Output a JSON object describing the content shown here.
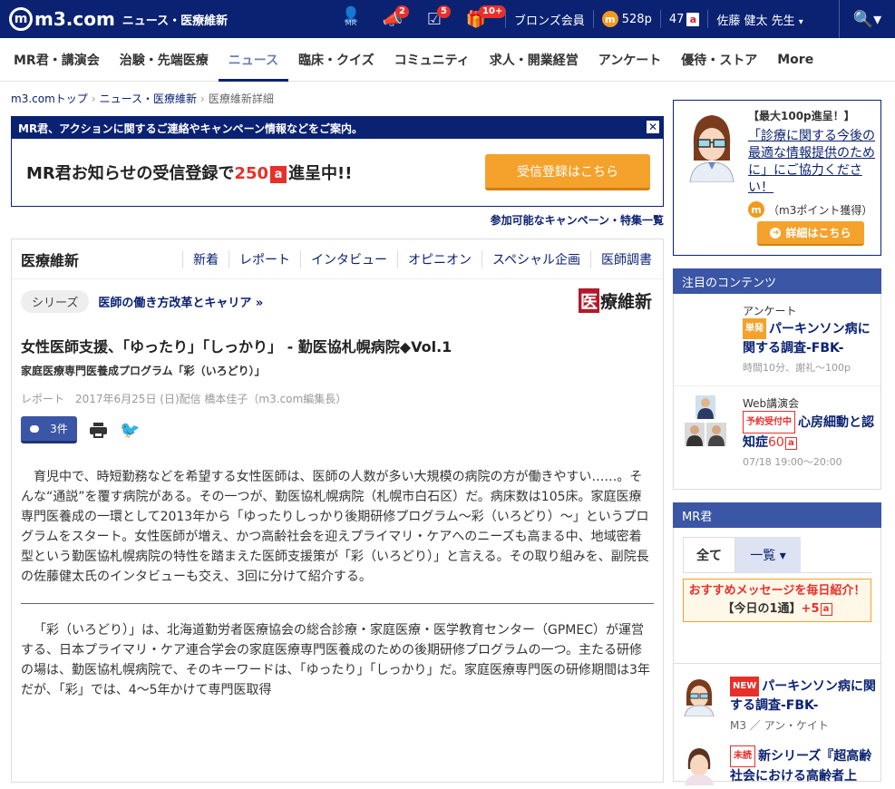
{
  "header": {
    "logo": "m3.com",
    "logo_mark": "m",
    "section": "ニュース・医療維新",
    "icon_badges": {
      "mr": "",
      "notifications": "2",
      "tasks": "5",
      "gifts": "10+"
    },
    "mr_label": "MR",
    "member_rank": "ブロンズ会員",
    "points": "528p",
    "point_mark": "m",
    "coupons": "47",
    "coupon_mark": "a",
    "user": "佐藤 健太 先生",
    "user_caret": "▾",
    "search_glyph": "🔍▾"
  },
  "nav": [
    "MR君・講演会",
    "治験・先端医療",
    "ニュース",
    "臨床・クイズ",
    "コミュニティ",
    "求人・開業経営",
    "アンケート",
    "優待・ストア",
    "More"
  ],
  "breadcrumb": [
    "m3.comトップ",
    "ニュース・医療維新",
    "医療維新詳細"
  ],
  "notice": {
    "head": "MR君、アクションに関するご連絡やキャンペーン情報などをご案内。",
    "close": "✕",
    "text_pre": "MR君お知らせの受信登録で",
    "text_num": "250",
    "text_mark": "a",
    "text_post": "進呈中!!",
    "button": "受信登録はこちら",
    "campaign_link": "参加可能なキャンペーン・特集一覧"
  },
  "article": {
    "section_title": "医療維新",
    "tabs": [
      "新着",
      "レポート",
      "インタビュー",
      "オピニオン",
      "スペシャル企画",
      "医師調書"
    ],
    "series_tag": "シリーズ",
    "series_link": "医師の働き方改革とキャリア »",
    "brand_k": "医",
    "brand_rest": "療維新",
    "title": "女性医師支援、「ゆったり」「しっかり」 - 勤医協札幌病院◆Vol.1",
    "subtitle": "家庭医療専門医養成プログラム「彩（いろどり）」",
    "meta": "レポート　2017年6月25日 (日)配信 橋本佳子（m3.com編集長）",
    "comment_count": "3件",
    "tw": "🐦",
    "body1": "育児中で、時短勤務などを希望する女性医師は、医師の人数が多い大規模の病院の方が働きやすい……。そんな“通説”を覆す病院がある。その一つが、勤医協札幌病院（札幌市白石区）だ。病床数は105床。家庭医療専門医養成の一環として2013年から「ゆったりしっかり後期研修プログラム～彩（いろどり）～」というプログラムをスタート。女性医師が増え、かつ高齢社会を迎えプライマリ・ケアへのニーズも高まる中、地域密着型という勤医協札幌病院の特性を踏まえた医師支援策が「彩（いろどり）」と言える。その取り組みを、副院長の佐藤健太氏のインタビューも交え、3回に分けて紹介する。",
    "body2": "「彩（いろどり）」は、北海道勤労者医療協会の総合診療・家庭医療・医学教育センター（GPMEC）が運営する、日本プライマリ・ケア連合学会の家庭医療専門医養成のための後期研修プログラムの一つ。主たる研修の場は、勤医協札幌病院で、そのキーワードは、「ゆったり」「しっかり」だ。家庭医療専門医の研修期間は3年だが、「彩」では、4～5年かけて専門医取得"
  },
  "side": {
    "ad_title": "【最大100p進呈！】",
    "ad_link": "「診療に関する今後の最適な情報提供のために」にご協力ください！",
    "ad_point": "（m3ポイント獲得）",
    "ad_point_mark": "m",
    "ad_button": "詳細はこちら",
    "ad_button_arrow": "➜",
    "featured_head": "注目のコンテンツ",
    "featured": [
      {
        "category": "アンケート",
        "tag": "単発",
        "title": "パーキンソン病に関する調査-FBK-",
        "sub": "時間10分、謝礼～100p"
      },
      {
        "category": "Web講演会",
        "tag": "予約受付中",
        "title": "心房細動と認知症",
        "title_num": "60",
        "title_mark": "a",
        "sub": "07/18 19:00～20:00"
      }
    ],
    "mr_head": "MR君",
    "mr_tab_all": "全て",
    "mr_tab_list": "一覧 ▾",
    "rec_line1": "おすすめメッセージを毎日紹介！",
    "rec_line2_pre": "【今日の1通】",
    "rec_line2_pt": "+5",
    "rec_mark": "a",
    "mr_items": [
      {
        "tag": "NEW",
        "title": "パーキンソン病に関する調査-FBK-",
        "sub": "M3 ／ アン・ケイト"
      },
      {
        "tag": "未読",
        "title": "新シリーズ『超高齢社会における高齢者上"
      }
    ]
  },
  "colors": {
    "navy": "#0b2272",
    "accent_blue": "#3a56a5",
    "orange": "#f5a22c",
    "red": "#e8302b"
  }
}
